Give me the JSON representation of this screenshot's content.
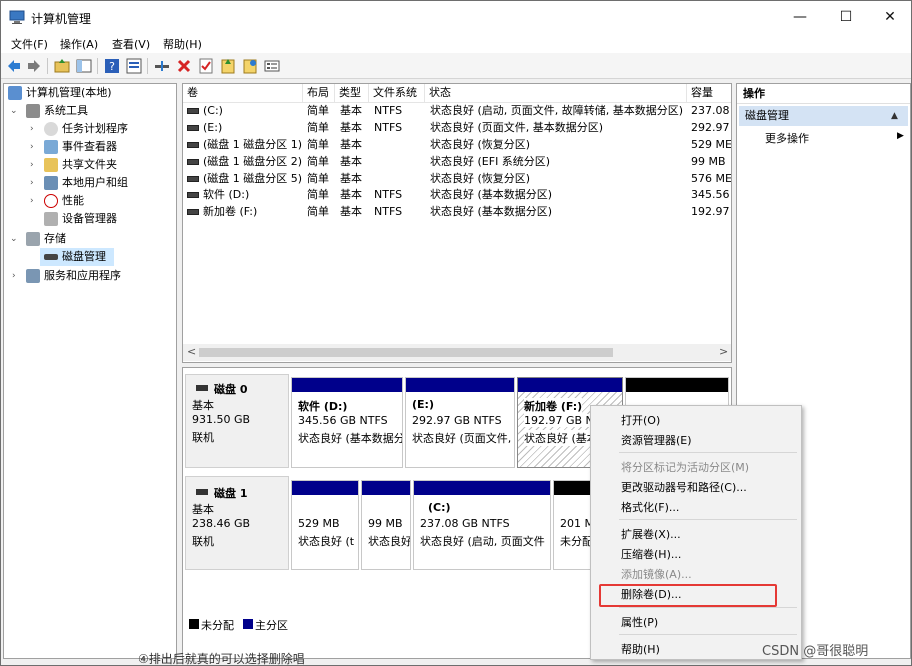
{
  "window": {
    "title": "计算机管理",
    "minimize_glyph": "—",
    "maximize_glyph": "☐",
    "close_glyph": "✕"
  },
  "menubar": {
    "items": [
      "文件(F)",
      "操作(A)",
      "查看(V)",
      "帮助(H)"
    ]
  },
  "toolbar": {
    "icons": [
      "back-arrow-icon",
      "forward-arrow-icon",
      "folder-up-icon",
      "console-tree-icon",
      "help-icon",
      "properties-icon",
      "connect-icon",
      "delete-icon",
      "check-icon",
      "import-icon",
      "export-icon",
      "details-icon"
    ]
  },
  "tree": {
    "root": "计算机管理(本地)",
    "system_tools": "系统工具",
    "task_scheduler": "任务计划程序",
    "event_viewer": "事件查看器",
    "shared_folders": "共享文件夹",
    "local_users": "本地用户和组",
    "performance": "性能",
    "device_manager": "设备管理器",
    "storage": "存储",
    "disk_management": "磁盘管理",
    "services_apps": "服务和应用程序"
  },
  "volume_list": {
    "columns": [
      "卷",
      "布局",
      "类型",
      "文件系统",
      "状态",
      "容量"
    ],
    "rows": [
      {
        "volume": "(C:)",
        "layout": "简单",
        "type": "基本",
        "fs": "NTFS",
        "status": "状态良好 (启动, 页面文件, 故障转储, 基本数据分区)",
        "capacity": "237.08"
      },
      {
        "volume": "(E:)",
        "layout": "简单",
        "type": "基本",
        "fs": "NTFS",
        "status": "状态良好 (页面文件, 基本数据分区)",
        "capacity": "292.97"
      },
      {
        "volume": "(磁盘 1 磁盘分区 1)",
        "layout": "简单",
        "type": "基本",
        "fs": "",
        "status": "状态良好 (恢复分区)",
        "capacity": "529 ME"
      },
      {
        "volume": "(磁盘 1 磁盘分区 2)",
        "layout": "简单",
        "type": "基本",
        "fs": "",
        "status": "状态良好 (EFI 系统分区)",
        "capacity": "99 MB"
      },
      {
        "volume": "(磁盘 1 磁盘分区 5)",
        "layout": "简单",
        "type": "基本",
        "fs": "",
        "status": "状态良好 (恢复分区)",
        "capacity": "576 ME"
      },
      {
        "volume": "软件 (D:)",
        "layout": "简单",
        "type": "基本",
        "fs": "NTFS",
        "status": "状态良好 (基本数据分区)",
        "capacity": "345.56"
      },
      {
        "volume": "新加卷 (F:)",
        "layout": "简单",
        "type": "基本",
        "fs": "NTFS",
        "status": "状态良好 (基本数据分区)",
        "capacity": "192.97"
      }
    ],
    "scroll_left": "<",
    "scroll_right": ">"
  },
  "disks": [
    {
      "name": "磁盘 0",
      "kind": "基本",
      "size": "931.50 GB",
      "state": "联机",
      "partitions": [
        {
          "title": "软件  (D:)",
          "line1": "345.56 GB NTFS",
          "line2": "状态良好 (基本数据分"
        },
        {
          "title": "(E:)",
          "line1": "292.97 GB NTFS",
          "line2": "状态良好 (页面文件,"
        },
        {
          "title": "新加卷  (F:)",
          "line1": "192.97 GB N",
          "line2": "状态良好 (基本"
        },
        {
          "title": "",
          "line1": "",
          "line2": ""
        }
      ]
    },
    {
      "name": "磁盘 1",
      "kind": "基本",
      "size": "238.46 GB",
      "state": "联机",
      "partitions": [
        {
          "title": "",
          "line1": "529 MB",
          "line2": "状态良好 (t"
        },
        {
          "title": "",
          "line1": "99 MB",
          "line2": "状态良好"
        },
        {
          "title": "(C:)",
          "line1": "237.08 GB NTFS",
          "line2": "状态良好 (启动, 页面文件"
        },
        {
          "title": "",
          "line1": "201 M",
          "line2": "未分配"
        }
      ]
    }
  ],
  "legend": {
    "unallocated": "未分配",
    "primary": "主分区"
  },
  "actions": {
    "header": "操作",
    "section": "磁盘管理",
    "more": "更多操作",
    "section_arrow": "▲",
    "more_arrow": "▶"
  },
  "context_menu": {
    "items": [
      {
        "label": "打开(O)",
        "enabled": true
      },
      {
        "label": "资源管理器(E)",
        "enabled": true
      },
      {
        "label": "将分区标记为活动分区(M)",
        "enabled": false
      },
      {
        "label": "更改驱动器号和路径(C)...",
        "enabled": true
      },
      {
        "label": "格式化(F)...",
        "enabled": true
      },
      {
        "label": "扩展卷(X)...",
        "enabled": true
      },
      {
        "label": "压缩卷(H)...",
        "enabled": true
      },
      {
        "label": "添加镜像(A)...",
        "enabled": false
      },
      {
        "label": "删除卷(D)...",
        "enabled": true
      },
      {
        "label": "属性(P)",
        "enabled": true
      },
      {
        "label": "帮助(H)",
        "enabled": true
      }
    ]
  },
  "caption": "④排出后就真的可以选择删除唱",
  "watermark": "CSDN @哥很聪明",
  "colors": {
    "primary_partition": "#00008b",
    "unallocated": "#000000",
    "highlight_box": "#e53935",
    "selected_bg": "#cde8ff",
    "actions_section_bg": "#d4e3f4"
  }
}
